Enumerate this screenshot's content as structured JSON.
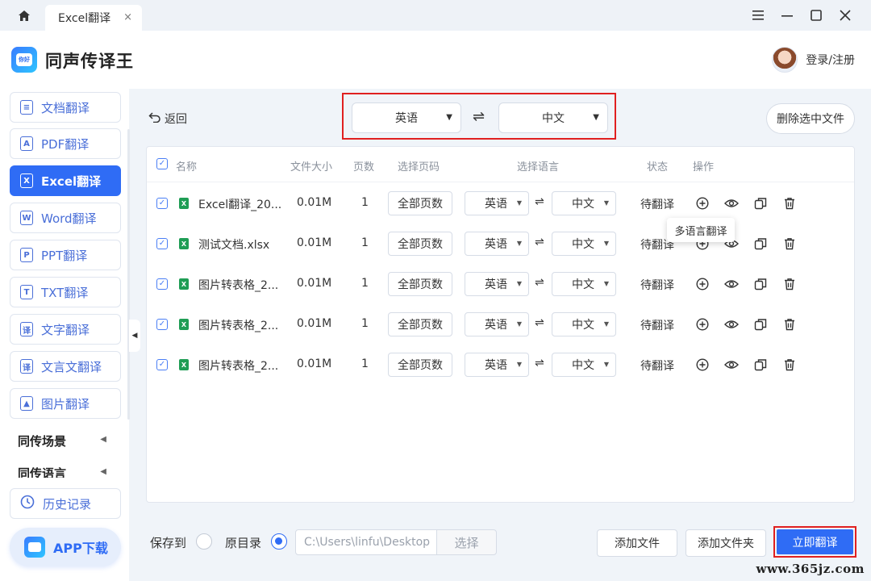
{
  "titlebar": {
    "tab_title": "Excel翻译",
    "tab_close": "×"
  },
  "header": {
    "app_name": "同声传译王",
    "user_label": "登录/注册",
    "logo_text": "你好"
  },
  "sidebar": {
    "items": [
      {
        "label": "文档翻译",
        "icon": "document-icon",
        "glyph": "≡"
      },
      {
        "label": "PDF翻译",
        "icon": "pdf-icon",
        "glyph": "A"
      },
      {
        "label": "Excel翻译",
        "icon": "excel-icon",
        "glyph": "X",
        "active": true
      },
      {
        "label": "Word翻译",
        "icon": "word-icon",
        "glyph": "W"
      },
      {
        "label": "PPT翻译",
        "icon": "ppt-icon",
        "glyph": "P"
      },
      {
        "label": "TXT翻译",
        "icon": "txt-icon",
        "glyph": "T"
      },
      {
        "label": "文字翻译",
        "icon": "text-icon",
        "glyph": "译"
      },
      {
        "label": "文言文翻译",
        "icon": "classical-icon",
        "glyph": "译"
      },
      {
        "label": "图片翻译",
        "icon": "image-icon",
        "glyph": "▲"
      }
    ],
    "sections": [
      "同传场景",
      "同传语言"
    ],
    "history": "历史记录",
    "app_download": "APP下载"
  },
  "toolbar": {
    "back_label": "返回",
    "source_lang": "英语",
    "target_lang": "中文",
    "delete_selected": "删除选中文件"
  },
  "table": {
    "headers": {
      "name": "名称",
      "size": "文件大小",
      "pages": "页数",
      "select_pages": "选择页码",
      "select_lang": "选择语言",
      "status": "状态",
      "action": "操作"
    },
    "rows": [
      {
        "name": "Excel翻译_20...",
        "size": "0.01M",
        "pages": "1",
        "page_range": "全部页数",
        "from": "英语",
        "to": "中文",
        "status": "待翻译"
      },
      {
        "name": "测试文档.xlsx",
        "size": "0.01M",
        "pages": "1",
        "page_range": "全部页数",
        "from": "英语",
        "to": "中文",
        "status": "待翻译"
      },
      {
        "name": "图片转表格_2...",
        "size": "0.01M",
        "pages": "1",
        "page_range": "全部页数",
        "from": "英语",
        "to": "中文",
        "status": "待翻译"
      },
      {
        "name": "图片转表格_2...",
        "size": "0.01M",
        "pages": "1",
        "page_range": "全部页数",
        "from": "英语",
        "to": "中文",
        "status": "待翻译"
      },
      {
        "name": "图片转表格_2...",
        "size": "0.01M",
        "pages": "1",
        "page_range": "全部页数",
        "from": "英语",
        "to": "中文",
        "status": "待翻译"
      }
    ],
    "tooltip": "多语言翻译"
  },
  "footer": {
    "save_to": "保存到",
    "original_dir": "原目录",
    "path_placeholder": "C:\\Users\\linfu\\Desktop",
    "choose": "选择",
    "add_file": "添加文件",
    "add_folder": "添加文件夹",
    "start": "立即翻译"
  },
  "watermark": "www.365jz.com",
  "colors": {
    "accent": "#2f6cf5",
    "highlight_border": "#e02020",
    "excel_green": "#1f9d55"
  }
}
